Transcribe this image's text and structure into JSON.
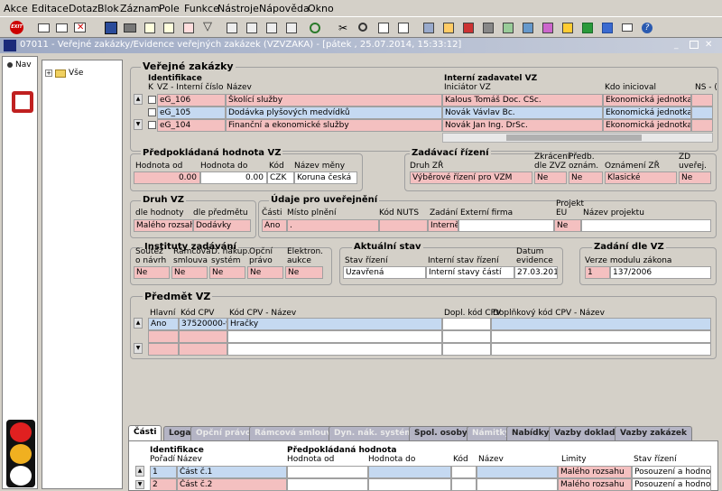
{
  "menu": [
    "Akce",
    "Editace",
    "Dotaz",
    "Blok",
    "Záznam",
    "Pole",
    "Funkce",
    "Nástroje",
    "Nápověda",
    "Okno"
  ],
  "toolbar": {
    "exit_label": "EXIT"
  },
  "window": {
    "title": "07011 - Veřejné zakázky/Evidence veřejných zakázek (VZVZAKA) - [pátek , 25.07.2014, 15:33:12]"
  },
  "nav": {
    "label": "Nav"
  },
  "tree": {
    "root": "Vše"
  },
  "vz": {
    "title": "Veřejné zakázky",
    "ident_header": "Identifikace",
    "col_k": "K",
    "col_vz": "VZ - Interní číslo",
    "col_nazev": "Název",
    "interni_header": "Interní zadavatel VZ",
    "col_iniciator": "Iniciátor VZ",
    "col_kdo": "Kdo inicioval",
    "col_ns": "NS - (",
    "rows": [
      {
        "cislo": "eG_106",
        "nazev": "Školící služby",
        "iniciator": "Kalous Tomáš Doc. CSc.",
        "kdo": "Ekonomická jednotka"
      },
      {
        "cislo": "eG_105",
        "nazev": "Dodávka plyšových medvídků",
        "iniciator": "Novák Vávlav Bc.",
        "kdo": "Ekonomická jednotka"
      },
      {
        "cislo": "eG_104",
        "nazev": "Finanční a ekonomické služby",
        "iniciator": "Novák Jan Ing. DrSc.",
        "kdo": "Ekonomická jednotka"
      }
    ]
  },
  "hodnota": {
    "title": "Předpokládaná hodnota VZ",
    "l_od": "Hodnota od",
    "l_do": "Hodnota do",
    "l_kod": "Kód",
    "l_mena": "Název měny",
    "od": "0.00",
    "do": "0.00",
    "kod": "CZK",
    "mena": "Koruna česká"
  },
  "zadavaci": {
    "title": "Zadávací řízení",
    "l_druh": "Druh ZŘ",
    "l_zkr1": "Zkrácení",
    "l_zkr2": "dle ZVZ",
    "l_pred1": "Předb.",
    "l_pred2": "oznám.",
    "l_ozn": "Oznámení ZŘ",
    "l_zd1": "ZD",
    "l_zd2": "uveřej.",
    "druh": "Výběrové řízení pro VZM",
    "zkr": "Ne",
    "pred": "Ne",
    "ozn": "Klasické",
    "zd": "Ne"
  },
  "druhvz": {
    "title": "Druh VZ",
    "l_hod": "dle hodnoty",
    "l_pred": "dle předmětu",
    "hod": "Malého rozsahu",
    "pred": "Dodávky"
  },
  "udaje": {
    "title": "Údaje pro uveřejnění",
    "l_casti": "Části",
    "l_misto": "Místo plnění",
    "l_nuts": "Kód NUTS",
    "l_zadani": "Zadání",
    "l_firma": "Externí firma",
    "l_proj1": "Projekt",
    "l_proj2": "EU",
    "l_nazproj": "Název projektu",
    "casti": "Ano",
    "misto": ".",
    "zadani": "Interně",
    "proj": "Ne"
  },
  "instituty": {
    "title": "Instituty zadávání",
    "l_s1": "Soutěž",
    "l_s2": "o návrh",
    "l_r1": "Rámcová",
    "l_r2": "smlouva",
    "l_d1": "D. nákup.",
    "l_d2": "systém",
    "l_o1": "Opční",
    "l_o2": "právo",
    "l_e1": "Elektron.",
    "l_e2": "aukce",
    "s": "Ne",
    "r": "Ne",
    "d": "Ne",
    "o": "Ne",
    "e": "Ne"
  },
  "aktualni": {
    "title": "Aktuální stav",
    "l_stav": "Stav řízení",
    "l_int": "Interní stav řízení",
    "l_d1": "Datum",
    "l_d2": "evidence",
    "stav": "Uzavřená",
    "int": "Interní stavy částí",
    "datum": "27.03.2014"
  },
  "zadani": {
    "title": "Zadání dle VZ",
    "l_verze": "Verze modulu zákona",
    "verze": "1",
    "zakon": "137/2006"
  },
  "predmet": {
    "title": "Předmět VZ",
    "l_hlavni": "Hlavní",
    "l_kod": "Kód CPV",
    "l_nazev": "Kód CPV - Název",
    "l_dopl": "Dopl. kód CPV",
    "l_dopln": "Doplňkový kód CPV - Název",
    "hlavni": "Ano",
    "kod": "37520000-9",
    "nazev": "Hračky"
  },
  "tabs": [
    "Části",
    "Loga",
    "Opční právo",
    "Rámcová smlouva",
    "Dyn. nák. systém",
    "Spol. osoby",
    "Námitky",
    "Nabídky",
    "Vazby dokladů",
    "Vazby zakázek"
  ],
  "casti": {
    "ident": "Identifikace",
    "l_poradi": "Pořadí",
    "l_nazev": "Název",
    "pred": "Předpokládaná hodnota",
    "l_od": "Hodnota od",
    "l_do": "Hodnota do",
    "l_kod": "Kód",
    "l_naz2": "Název",
    "l_limity": "Limity",
    "l_stav": "Stav řízení",
    "rows": [
      {
        "poradi": "1",
        "nazev": "Část č.1",
        "limity": "Malého rozsahu",
        "stav": "Posouzení a hodnoce"
      },
      {
        "poradi": "2",
        "nazev": "Část č.2",
        "limity": "Malého rozsahu",
        "stav": "Posouzení a hodnoce"
      }
    ]
  }
}
